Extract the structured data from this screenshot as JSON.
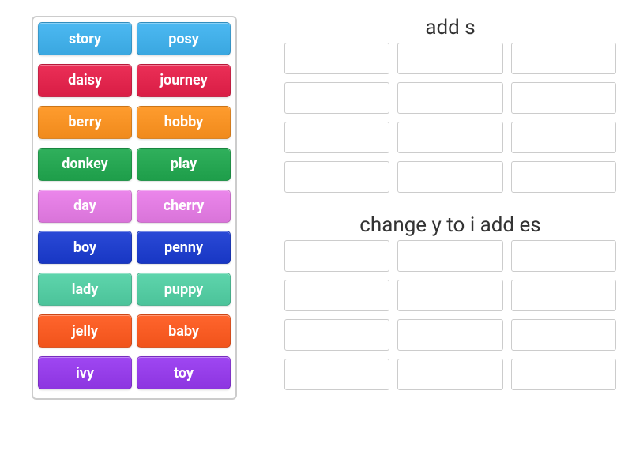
{
  "word_tiles": [
    {
      "label": "story",
      "color": "#3aa7e0"
    },
    {
      "label": "posy",
      "color": "#3aa7e0"
    },
    {
      "label": "daisy",
      "color": "#d91d45"
    },
    {
      "label": "journey",
      "color": "#d91d45"
    },
    {
      "label": "berry",
      "color": "#f08a1c"
    },
    {
      "label": "hobby",
      "color": "#f08a1c"
    },
    {
      "label": "donkey",
      "color": "#1e9e4a"
    },
    {
      "label": "play",
      "color": "#1e9e4a"
    },
    {
      "label": "day",
      "color": "#d974d9"
    },
    {
      "label": "cherry",
      "color": "#d974d9"
    },
    {
      "label": "boy",
      "color": "#1837c4"
    },
    {
      "label": "penny",
      "color": "#1837c4"
    },
    {
      "label": "lady",
      "color": "#4cc39a"
    },
    {
      "label": "puppy",
      "color": "#4cc39a"
    },
    {
      "label": "jelly",
      "color": "#f1531b"
    },
    {
      "label": "baby",
      "color": "#f1531b"
    },
    {
      "label": "ivy",
      "color": "#8d35e0"
    },
    {
      "label": "toy",
      "color": "#8d35e0"
    }
  ],
  "groups": [
    {
      "title": "add s",
      "slots": 12
    },
    {
      "title": "change y to i add es",
      "slots": 12
    }
  ]
}
